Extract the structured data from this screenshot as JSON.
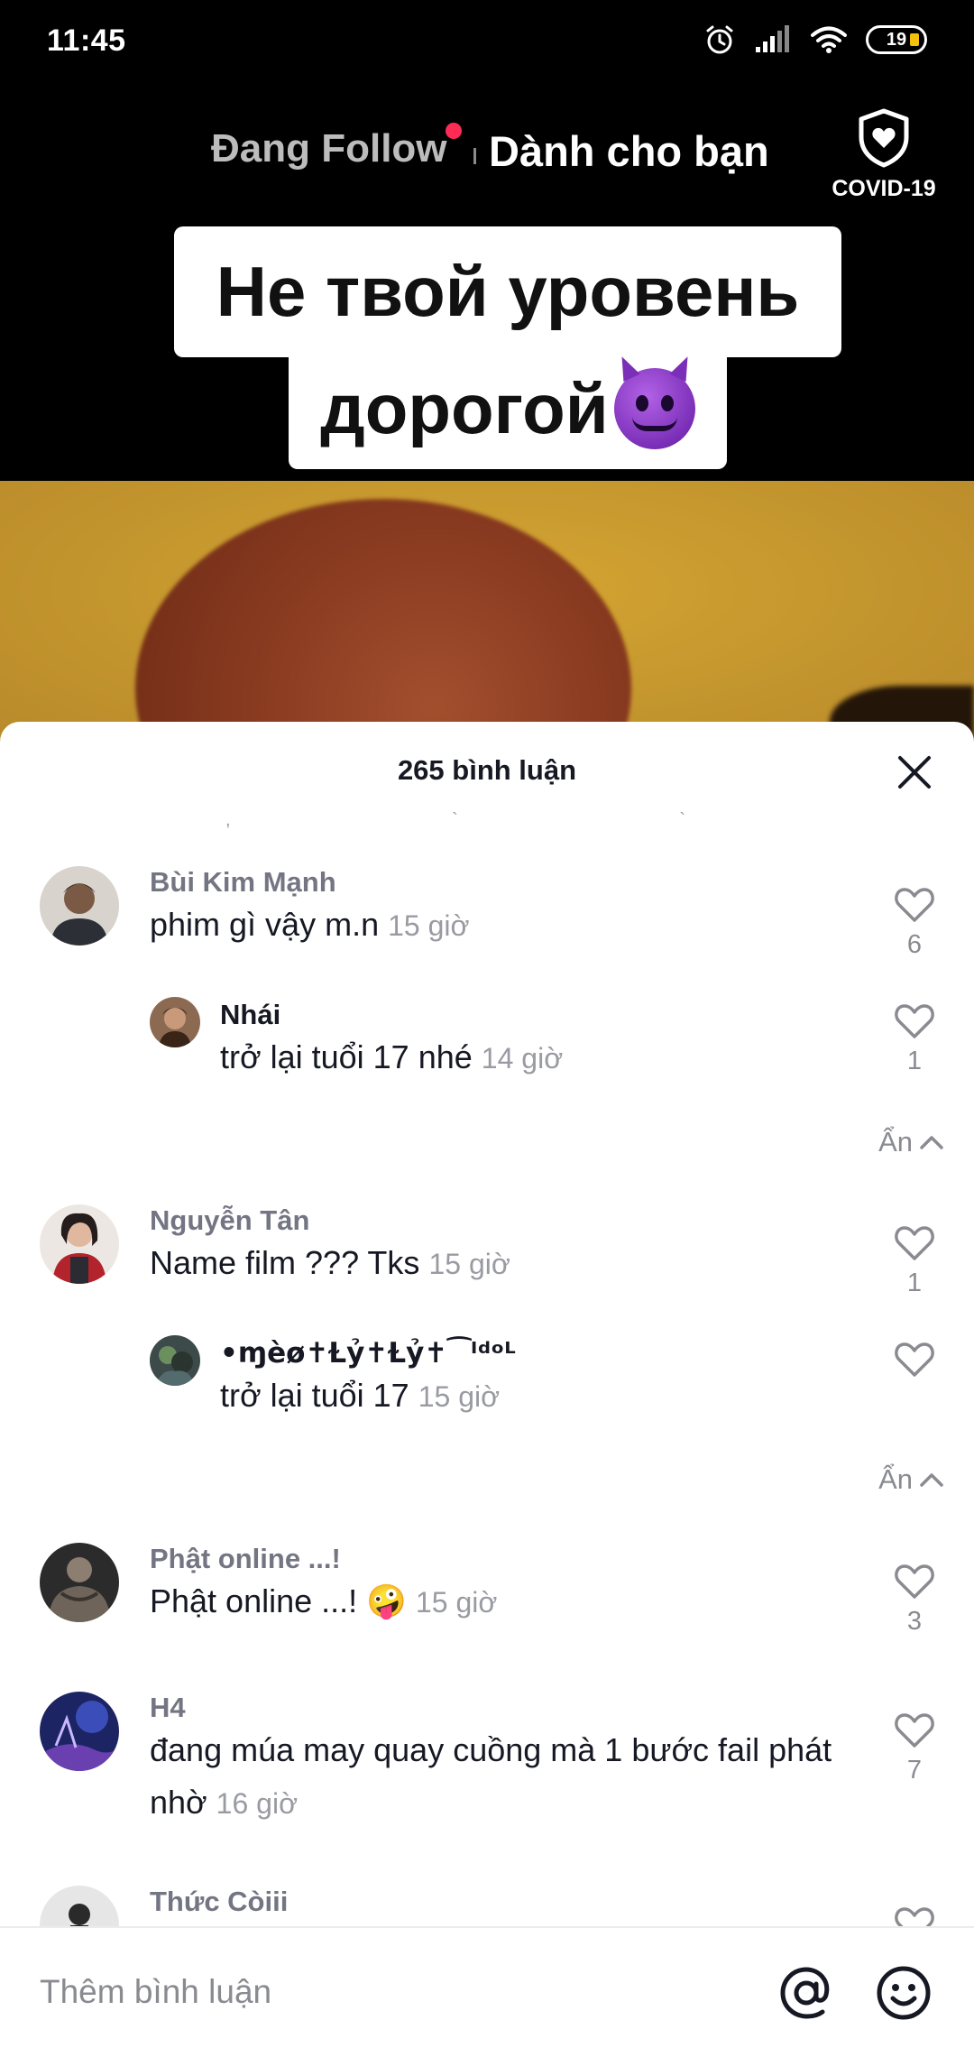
{
  "status_bar": {
    "time": "11:45",
    "battery": "19",
    "icons": [
      "alarm-icon",
      "signal-icon",
      "wifi-icon",
      "battery-icon"
    ]
  },
  "top_nav": {
    "following": "Đang Follow",
    "for_you": "Dành cho bạn",
    "covid_label": "COVID-19"
  },
  "video": {
    "caption_line1": "Не твой уровень",
    "caption_line2": "дорогой"
  },
  "comments_sheet": {
    "count": "265 bình luận",
    "hide_label": "Ẩn",
    "comments": [
      {
        "user": "Bùi Kim Mạnh",
        "text": "phim gì vậy m.n",
        "time": "15 giờ",
        "likes": "6"
      },
      {
        "user": "Nhái",
        "text": "trở lại tuổi 17 nhé",
        "time": "14 giờ",
        "likes": "1"
      },
      {
        "user": "Nguyễn Tân",
        "text": "Name film ??? Tks",
        "time": "15 giờ",
        "likes": "1"
      },
      {
        "user": "•ɱèø✝Ɫỷ✝Ɫỷ✝⁀ᴵᵈᵒᴸ",
        "text": "trở lại tuổi 17",
        "time": "15 giờ",
        "likes": ""
      },
      {
        "user": "Phật online ...!",
        "text": "Phật online ...! 🤪",
        "time": "15 giờ",
        "likes": "3"
      },
      {
        "user": "H4",
        "text": "đang múa may quay cuồng mà 1 bước fail phát nhờ",
        "time": "16 giờ",
        "likes": "7"
      },
      {
        "user": "Thức Còiii",
        "text": "",
        "time": "",
        "likes": ""
      }
    ]
  },
  "input_bar": {
    "placeholder": "Thêm bình luận"
  },
  "colors": {
    "accent_red": "#fe2c55",
    "text_primary": "#161823",
    "text_secondary": "#8a8b91"
  }
}
